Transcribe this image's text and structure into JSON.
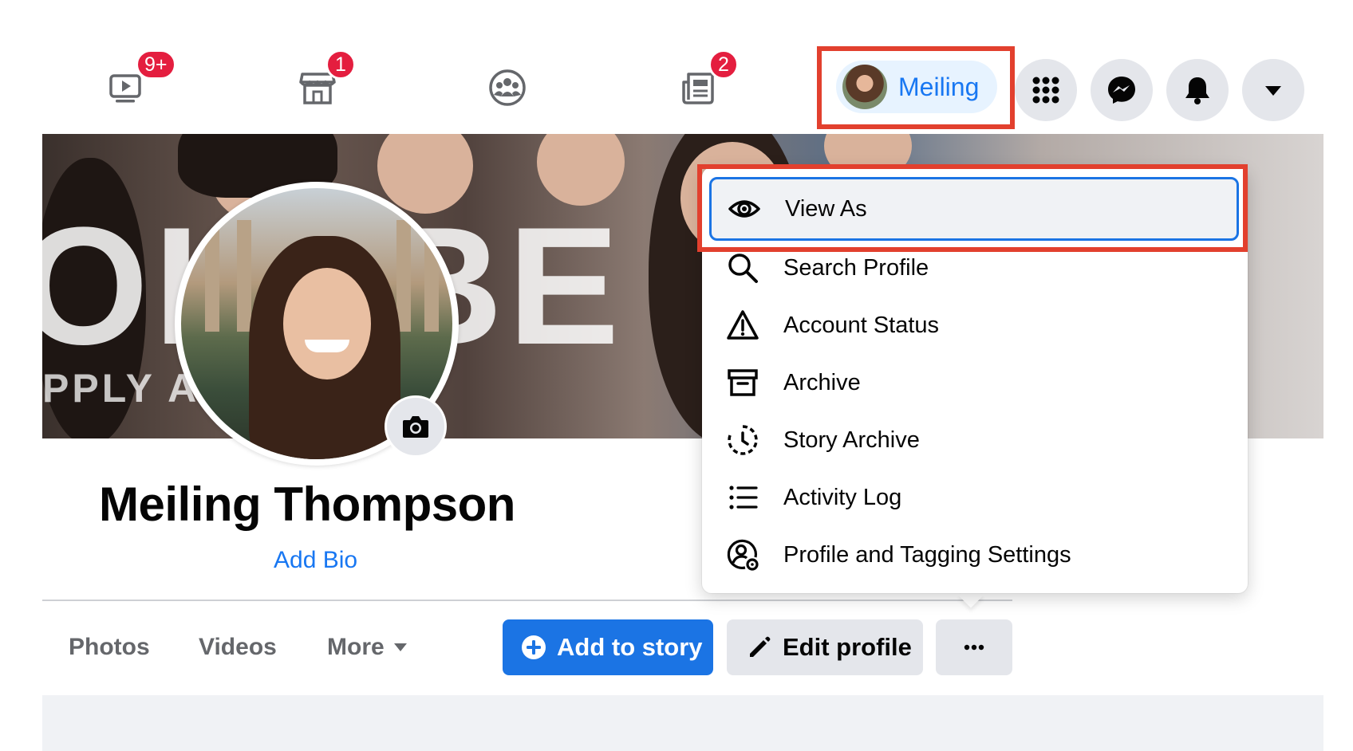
{
  "nav": {
    "tabs": [
      {
        "name": "watch",
        "icon": "video-play-icon",
        "badge": "9+"
      },
      {
        "name": "marketplace",
        "icon": "storefront-icon",
        "badge": "1"
      },
      {
        "name": "groups",
        "icon": "groups-icon",
        "badge": ""
      },
      {
        "name": "news",
        "icon": "newspaper-icon",
        "badge": "2"
      }
    ],
    "profile_chip": {
      "name": "Meiling",
      "avatar": "user-avatar"
    },
    "buttons": [
      {
        "name": "menu",
        "icon": "grid-menu-icon"
      },
      {
        "name": "messenger",
        "icon": "messenger-icon"
      },
      {
        "name": "notifications",
        "icon": "bell-icon"
      },
      {
        "name": "account",
        "icon": "caret-down-icon"
      }
    ]
  },
  "cover": {
    "overlay_text_large": "OI  CBE",
    "overlay_text_small": "PPLY AT          M/APPLY"
  },
  "profile": {
    "name": "Meiling Thompson",
    "bio_link": "Add Bio",
    "camera_icon": "camera-icon"
  },
  "profile_tabs": {
    "photos": "Photos",
    "videos": "Videos",
    "more": "More"
  },
  "actions": {
    "add_story": "Add to story",
    "edit_profile": "Edit profile",
    "more_icon": "ellipsis-icon"
  },
  "dropdown": {
    "items": [
      {
        "label": "View As",
        "icon": "eye-icon",
        "selected": true
      },
      {
        "label": "Search Profile",
        "icon": "search-icon"
      },
      {
        "label": "Account Status",
        "icon": "warning-icon"
      },
      {
        "label": "Archive",
        "icon": "archive-box-icon"
      },
      {
        "label": "Story Archive",
        "icon": "story-clock-icon"
      },
      {
        "label": "Activity Log",
        "icon": "list-icon"
      },
      {
        "label": "Profile and Tagging Settings",
        "icon": "profile-settings-icon"
      }
    ]
  },
  "colors": {
    "accent": "#1b74e4",
    "badge": "#e41e3f",
    "highlight": "#e2402e",
    "chip_bg": "#e7f3ff"
  }
}
